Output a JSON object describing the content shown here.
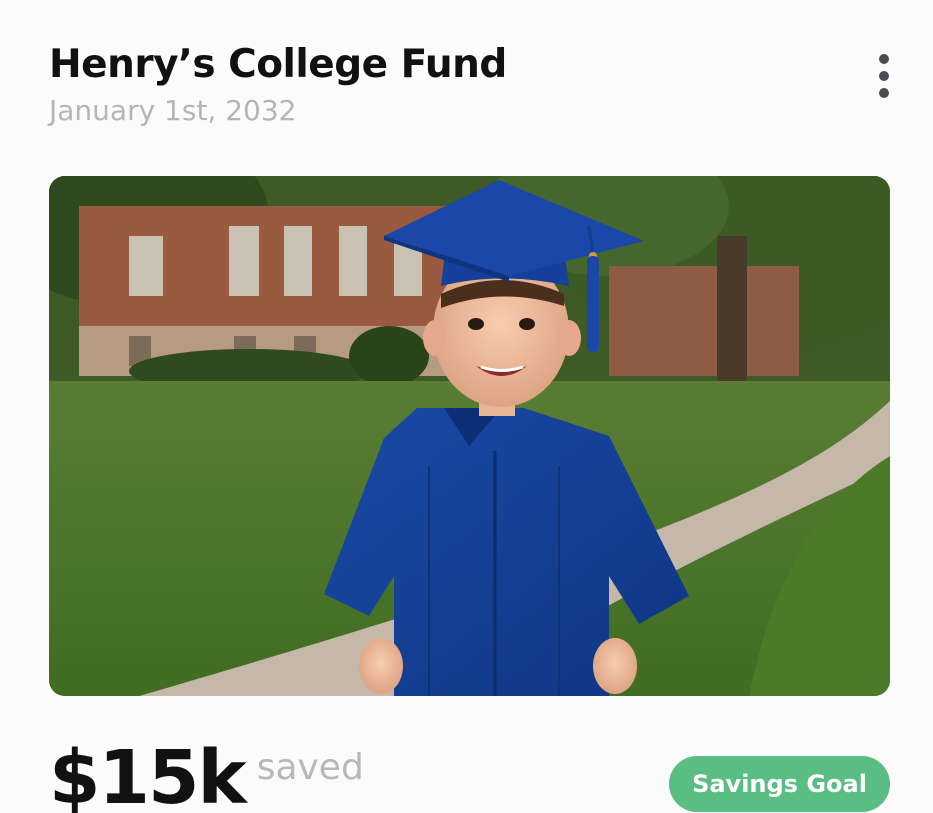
{
  "card": {
    "title": "Henry’s College Fund",
    "date": "January 1st, 2032",
    "menu_icon": "more-vertical-icon",
    "photo_alt": "Child in blue graduation cap and gown",
    "amount": "$15k",
    "amount_label": "saved",
    "badge_label": "Savings Goal"
  },
  "colors": {
    "title": "#111111",
    "subtitle": "#b5b5b8",
    "badge_bg": "#5abd83",
    "badge_text": "#ffffff",
    "gown_blue": "#123f96"
  }
}
